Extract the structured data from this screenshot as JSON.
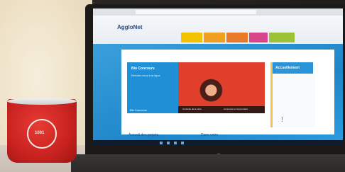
{
  "site": {
    "logo_text": "AggloNet"
  },
  "nav_items": [
    {
      "color": "#f2c200"
    },
    {
      "color": "#f0a020"
    },
    {
      "color": "#e87a2a"
    },
    {
      "color": "#d9458a"
    },
    {
      "color": "#9cc23a"
    }
  ],
  "hero": {
    "title": "Bio Concours",
    "subtitle": "Rendez-vous à la ligue",
    "footer": "Bio Concours"
  },
  "captions": {
    "left": "Conduite de la carte",
    "right": "Connexion et sa première"
  },
  "side_panel": {
    "header": "Accueillement"
  },
  "bottom_headings": {
    "left": "Accueil des projets",
    "right": "Dans votre"
  },
  "mug": {
    "emblem_text": "1001"
  },
  "colors": {
    "brand_blue": "#2a94d8",
    "accent_yellow": "#f2c44d",
    "mug_red": "#c8221f"
  }
}
